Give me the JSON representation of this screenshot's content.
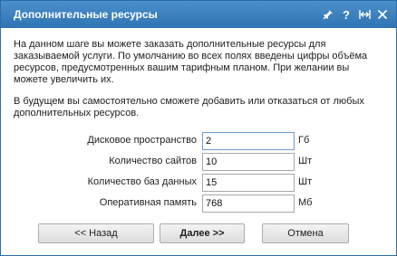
{
  "window": {
    "title": "Дополнительные ресурсы",
    "icons": [
      "pin-icon",
      "help-icon",
      "resize-icon",
      "close-icon"
    ],
    "help_label": "?"
  },
  "intro": {
    "paragraph1": "На данном шаге вы можете заказать дополнительные ресурсы для заказываемой услуги. По умолчанию во всех полях введены цифры объёма ресурсов, предусмотренных вашим тарифным планом. При желании вы можете увеличить их.",
    "paragraph2": "В будущем вы самостоятельно сможете добавить или отказаться от любых дополнительных ресурсов."
  },
  "fields": {
    "disk": {
      "label": "Дисковое пространство",
      "value": "2",
      "unit": "Гб"
    },
    "sites": {
      "label": "Количество сайтов",
      "value": "10",
      "unit": "Шт"
    },
    "databases": {
      "label": "Количество баз данных",
      "value": "15",
      "unit": "Шт"
    },
    "memory": {
      "label": "Оперативная память",
      "value": "768",
      "unit": "Мб"
    }
  },
  "buttons": {
    "back": "<< Назад",
    "next": "Далее >>",
    "cancel": "Отмена"
  },
  "colors": {
    "titlebar": "#3a7fbe",
    "border": "#2c6da8"
  }
}
